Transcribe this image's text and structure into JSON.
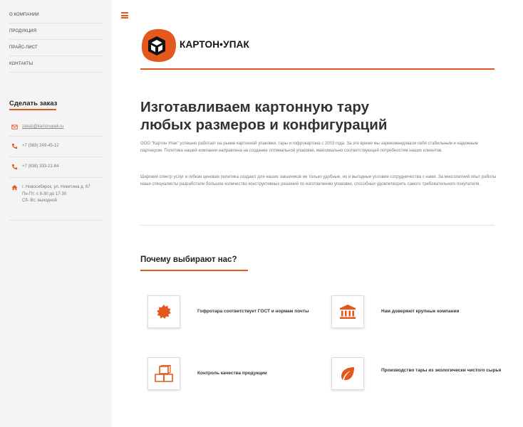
{
  "sidebar": {
    "nav": [
      "О КОМПАНИИ",
      "ПРОДУКЦИЯ",
      "ПРАЙС-ЛИСТ",
      "КОНТАКТЫ"
    ],
    "order_title": "Сделать заказ",
    "email": "zakaz@kartonupak.ru",
    "phone1": "+7 (383) 249-45-12",
    "phone2": "+7 (838) 333-21-84",
    "address": "г. Новосибирск, ул. Никитина д. 67",
    "hours1": "Пн-Пт: с 8-30 до 17-30",
    "hours2": "Сб- Вс: выходной"
  },
  "header": {
    "brand": "КАРТОН•УПАК"
  },
  "main": {
    "title_line1": "Изготавливаем картонную тару",
    "title_line2": "любых размеров и конфигураций",
    "para1": "ООО \"Картон Упак\" успешно работает на рынке картонной упаковки, тары и гофрокартона с 2003 года. За это время мы зарекомендовали себя стабильным и надежным партнером. Политика нашей компании направлена на создание оптимальной упаковки, максимально соответствующей потребностям наших клиентов.",
    "para2": "Широкий спектр услуг и гибкая ценовая политика создают для наших заказчиков не только удобные, но и выгодные условия сотрудничества с нами. За многолетний опыт работы наши специалисты разработали большое количество конструктивных решений по изготовлению упаковки, способных удовлетворить самого требовательного покупателя."
  },
  "why": {
    "title": "Почему выбирают нас?",
    "features": [
      "Гофротара соответствует ГОСТ и нормам почты",
      "Нам доверяют крупные компании",
      "Контроль качества продукции",
      "Производство тары из экологически чистого сырья"
    ]
  },
  "colors": {
    "accent": "#e4581c",
    "sidebar_bg": "#f4f4f4"
  },
  "icons": [
    "menu-icon",
    "envelope-icon",
    "phone-icon",
    "home-icon",
    "badge-icon",
    "bank-icon",
    "boxes-icon",
    "leaf-icon"
  ]
}
